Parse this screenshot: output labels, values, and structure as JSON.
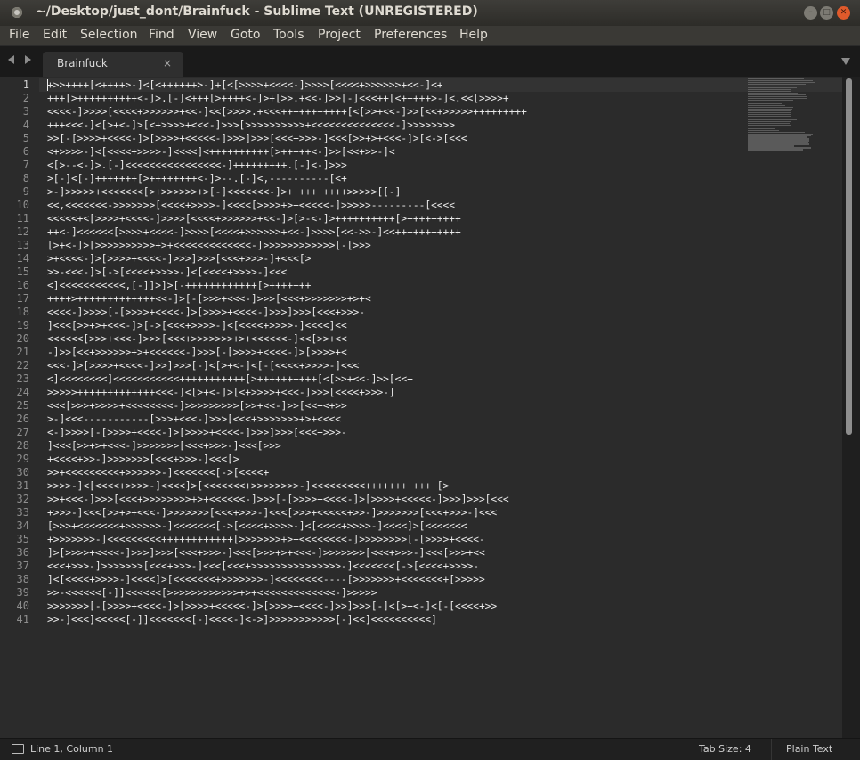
{
  "window": {
    "title": "~/Desktop/just_dont/Brainfuck - Sublime Text (UNREGISTERED)"
  },
  "menu": [
    "File",
    "Edit",
    "Selection",
    "Find",
    "View",
    "Goto",
    "Tools",
    "Project",
    "Preferences",
    "Help"
  ],
  "tab": {
    "label": "Brainfuck",
    "close": "×"
  },
  "editor": {
    "lines": [
      "+>>++++[<++++>-]<[<++++++>-]+[<[>>>>+<<<<-]>>>>[<<<<+>>>>>>+<<-]<+",
      "+++[>++++++++++<-]>.[-]<+++[>++++<-]>+[>>.+<<-]>>[-]<<<++[<+++++>-]<.<<[>>>>+",
      "<<<<-]>>>>[<<<<+>>>>>>+<<-]<<[>>>>.+<<<+++++++++++[<[>>+<<-]>>[<<+>>>>>+++++++++",
      "+++<<<-]<[>+<-]>[<+>>>>+<<<-]>>>[>>>>>>>>>>+<<<<<<<<<<<<<<-]>>>>>>>>",
      ">>[-[>>>>+<<<<-]>[>>>>+<<<<<-]>>>]>>>[<<<+>>>-]<<<[>>+>+<<<-]>[<->[<<<",
      "<+>>>>-]<[<<<<+>>>>-]<<<<]<++++++++++[>+++++<-]>>[<<+>>-]<",
      "<[>--<-]>.[-]<<<<<<<<<<<<<<<<-]+++++++++.[-]<-]>>>",
      ">[-]<[-]+++++++[>++++++++<-]>--.[-]<,----------[<+",
      ">-]>>>>>+<<<<<<<[>+>>>>>>+>[-]<<<<<<<-]>++++++++++>>>>>[[-]",
      "<<,<<<<<<<->>>>>>>[<<<<+>>>>-]<<<<[>>>>+>+<<<<<-]>>>>>---------[<<<<",
      "<<<<<+<[>>>>+<<<<-]>>>>[<<<<+>>>>>>+<<-]>[>-<-]>++++++++++[>+++++++++",
      "++<-]<<<<<<[>>>>+<<<<-]>>>>[<<<<+>>>>>>+<<-]>>>>[<<->>-]<<+++++++++++",
      "[>+<-]>[>>>>>>>>>>+>+<<<<<<<<<<<<<-]>>>>>>>>>>>>[-[>>>",
      ">+<<<<-]>[>>>>+<<<<-]>>>]>>>[<<<+>>>-]+<<<[>",
      ">>-<<<-]>[->[<<<<+>>>>-]<[<<<<+>>>>-]<<<",
      "<]<<<<<<<<<<<,[-]]>]>[-++++++++++++[>+++++++",
      "++++>+++++++++++++<<-]>[-[>>>+<<<-]>>>[<<<+>>>>>>>+>+<",
      "<<<<-]>>>>[-[>>>>+<<<<-]>[>>>>+<<<<-]>>>]>>>[<<<+>>>-",
      "]<<<[>>+>+<<<-]>[->[<<<+>>>>-]<[<<<<+>>>>-]<<<<]<<",
      "<<<<<<[>>>+<<<-]>>>[<<<+>>>>>>>+>+<<<<<<-]<<[>>+<<",
      "-]>>[<<+>>>>>>+>+<<<<<<-]>>>[-[>>>>+<<<<-]>[>>>>+<",
      "<<<-]>[>>>>+<<<<-]>>]>>>[-]<[>+<-]<[-[<<<<+>>>>-]<<<",
      "<]<<<<<<<<]<<<<<<<<<<<+++++++++++[>++++++++++[<[>>+<<-]>>[<<+",
      ">>>>>+++++++++++++<<<-]<[>+<-]>[<+>>>>+<<<-]>>>[<<<<+>>>-]",
      "<<<[>>>+>>>>+<<<<<<<<-]>>>>>>>>>[>>+<<-]>>[<<+<+>>",
      ">-]<<<-----------[>>>+<<<-]>>>[<<<+>>>>>>>+>+<<<<",
      "<-]>>>>[-[>>>>+<<<<-]>[>>>>+<<<<-]>>>]>>>[<<<+>>>-",
      "]<<<[>>+>+<<<-]>>>>>>>[<<<+>>>-]<<<[>>>",
      "+<<<<+>>-]>>>>>>>[<<<+>>>-]<<<[>",
      ">>+<<<<<<<<<+>>>>>>-]<<<<<<<[->[<<<<+",
      ">>>>-]<[<<<<+>>>>-]<<<<]>[<<<<<<<+>>>>>>>>-]<<<<<<<<<++++++++++++[>",
      ">>+<<<-]>>>[<<<+>>>>>>>>+>+<<<<<<-]>>>[-[>>>>+<<<<-]>[>>>>+<<<<<-]>>>]>>>[<<<",
      "+>>>-]<<<[>>+>+<<<-]>>>>>>>[<<<+>>>-]<<<[>>>+<<<<<+>>-]>>>>>>>[<<<+>>>-]<<<",
      "[>>>+<<<<<<<+>>>>>>-]<<<<<<<[->[<<<<+>>>>-]<[<<<<+>>>>-]<<<<]>[<<<<<<<",
      "+>>>>>>>-]<<<<<<<<<++++++++++++[>>>>>>>+>+<<<<<<<<-]>>>>>>>>[-[>>>>+<<<<-",
      "]>[>>>>+<<<<-]>>>]>>>[<<<+>>>-]<<<[>>>+>+<<<-]>>>>>>>[<<<+>>>-]<<<[>>>+<<",
      "<<<+>>>-]>>>>>>>[<<<+>>>-]<<<[<<<+>>>>>>>>>>>>>>>-]<<<<<<<[->[<<<<+>>>>-",
      "]<[<<<<+>>>>-]<<<<]>[<<<<<<<+>>>>>>>-]<<<<<<<<----[>>>>>>>+<<<<<<<+[>>>>>",
      ">>-<<<<<<[-]]<<<<<<[>>>>>>>>>>>>+>+<<<<<<<<<<<<<-]>>>>>",
      ">>>>>>>[-[>>>>+<<<<-]>[>>>>+<<<<<-]>[>>>>+<<<<-]>>]>>>[-]<[>+<-]<[-[<<<<+>>",
      ">>-]<<<]<<<<<[-]]<<<<<<<[-]<<<<-]<->]>>>>>>>>>>>[-]<<]<<<<<<<<<<]"
    ]
  },
  "status": {
    "position": "Line 1, Column 1",
    "tab_size": "Tab Size: 4",
    "syntax": "Plain Text"
  }
}
